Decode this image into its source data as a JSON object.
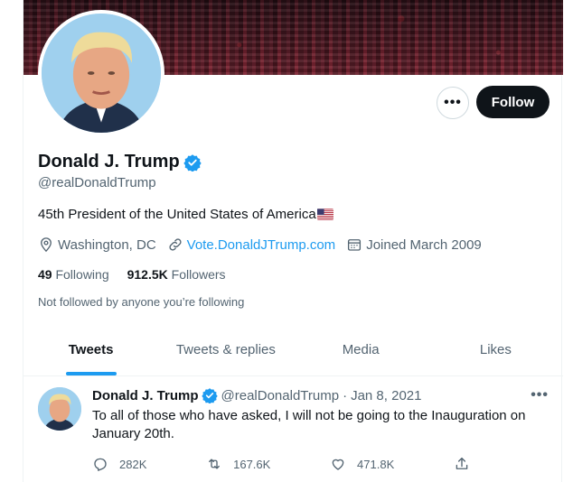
{
  "profile": {
    "name": "Donald J. Trump",
    "handle": "@realDonaldTrump",
    "bio": "45th President of the United States of America",
    "location": "Washington, DC",
    "website": "Vote.DonaldJTrump.com",
    "joined": "Joined March 2009",
    "following_count": "49",
    "following_label": "Following",
    "followers_count": "912.5K",
    "followers_label": "Followers",
    "not_followed_text": "Not followed by anyone you’re following",
    "follow_label": "Follow",
    "more_label": "•••"
  },
  "tabs": [
    {
      "label": "Tweets",
      "active": true
    },
    {
      "label": "Tweets & replies",
      "active": false
    },
    {
      "label": "Media",
      "active": false
    },
    {
      "label": "Likes",
      "active": false
    }
  ],
  "tweet": {
    "name": "Donald J. Trump",
    "handle": "@realDonaldTrump",
    "separator": "·",
    "date": "Jan 8, 2021",
    "text": "To all of those who have asked, I will not be going to the Inauguration on January 20th.",
    "more_label": "•••",
    "replies": "282K",
    "retweets": "167.6K",
    "likes": "471.8K"
  },
  "colors": {
    "accent": "#1d9bf0",
    "text_primary": "#0f1419",
    "text_secondary": "#536471",
    "follow_button": "#0f1419"
  },
  "icons": [
    "verified-badge-icon",
    "location-pin-icon",
    "link-icon",
    "calendar-icon",
    "reply-icon",
    "retweet-icon",
    "like-icon",
    "share-icon",
    "us-flag-icon"
  ]
}
